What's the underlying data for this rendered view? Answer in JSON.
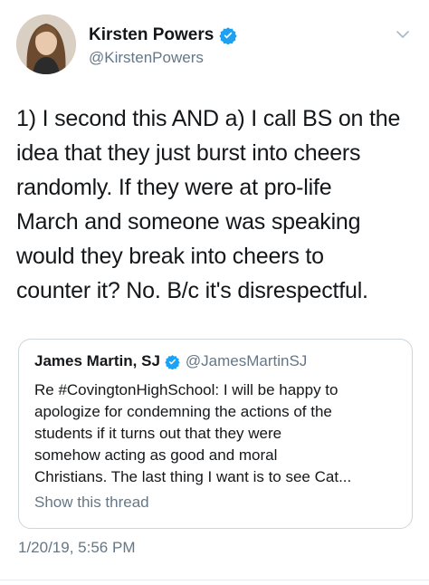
{
  "tweet": {
    "author_name": "Kirsten Powers",
    "author_handle": "@KirstenPowers",
    "text": "1) I second this AND a) I call BS on the\nidea that they just burst into cheers\nrandomly.  If they were at pro-life\nMarch and someone was speaking\nwould they break into cheers to\ncounter it?  No.  B/c it's disrespectful.",
    "timestamp": "1/20/19, 5:56 PM"
  },
  "quoted_tweet": {
    "author_name": "James Martin, SJ",
    "author_handle": "@JamesMartinSJ",
    "text": "Re #CovingtonHighSchool:  I will be happy to\napologize for condemning the actions of the\nstudents if it turns out that they were\nsomehow acting as good and moral\nChristians. The last thing I want is to see Cat...",
    "show_thread_label": "Show this thread"
  },
  "icons": {
    "verified": "verified-badge-icon",
    "menu": "chevron-down-icon"
  },
  "colors": {
    "verified": "#1da1f2",
    "text": "#14171a",
    "secondary": "#657786",
    "border": "#ccd6dd"
  }
}
